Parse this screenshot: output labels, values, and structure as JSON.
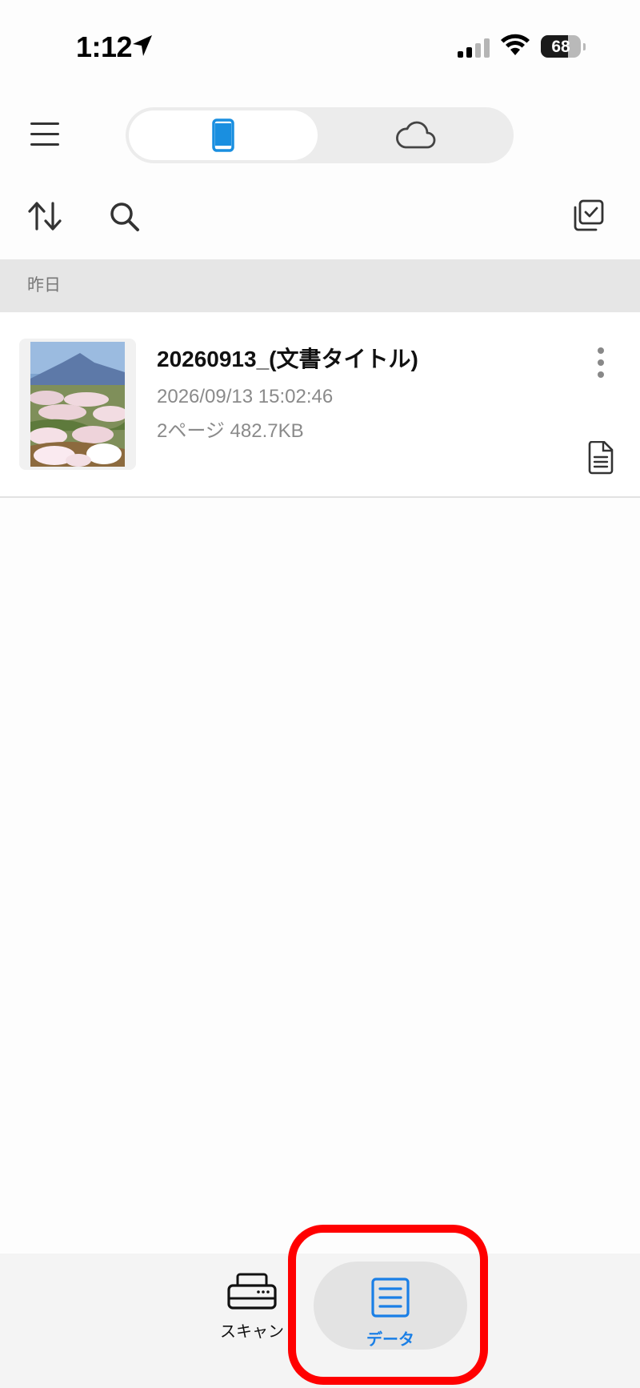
{
  "status_bar": {
    "time": "1:12",
    "battery_level": "68",
    "battery_fraction": 0.68,
    "icons": [
      "location-arrow-icon",
      "cellular-signal-icon",
      "wifi-icon",
      "battery-icon"
    ]
  },
  "header": {
    "menu_icon": "hamburger-menu-icon",
    "segments": [
      {
        "icon": "smartphone-icon",
        "selected": true
      },
      {
        "icon": "cloud-icon",
        "selected": false
      }
    ],
    "accent_color": "#1a8fe0"
  },
  "toolbar": {
    "icons": [
      "sort-icon",
      "search-icon",
      "multi-select-icon"
    ]
  },
  "list": {
    "section_label": "昨日",
    "items": [
      {
        "title": "20260913_(文書タイトル)",
        "datetime": "2026/09/13 15:02:46",
        "meta": "2ページ 482.7KB",
        "thumbnail": "painting-thumbnail",
        "type_icon": "document-icon"
      }
    ]
  },
  "tab_bar": {
    "tabs": [
      {
        "label": "スキャン",
        "icon": "scanner-icon",
        "selected": false
      },
      {
        "label": "データ",
        "icon": "data-list-icon",
        "selected": true
      }
    ],
    "selected_color": "#1a7fe6",
    "highlight_color": "#ff0000"
  }
}
